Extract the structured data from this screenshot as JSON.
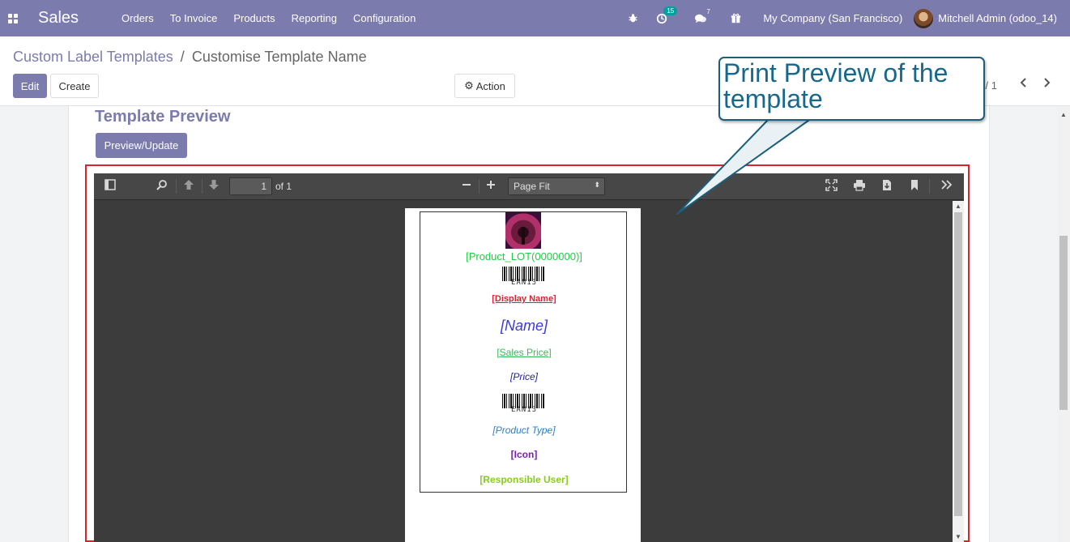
{
  "navbar": {
    "app_name": "Sales",
    "menu": [
      "Orders",
      "To Invoice",
      "Products",
      "Reporting",
      "Configuration"
    ],
    "activity_badge": "15",
    "messages_count": "7",
    "company": "My Company (San Francisco)",
    "user": "Mitchell Admin (odoo_14)"
  },
  "breadcrumb": {
    "parent": "Custom Label Templates",
    "separator": "/",
    "current": "Customise Template Name"
  },
  "buttons": {
    "edit": "Edit",
    "create": "Create",
    "action": "Action",
    "preview_update": "Preview/Update"
  },
  "pager": {
    "value": "1 / 1"
  },
  "section": {
    "title": "Template Preview"
  },
  "pdf_viewer": {
    "page_number": "1",
    "of_total": "of 1",
    "zoom": "Page Fit"
  },
  "label": {
    "product_lot": "[Product_LOT(0000000)]",
    "barcode1_text": "EAN13",
    "display_name": "[Display Name]",
    "name": "[Name]",
    "sales_price": "[Sales Price]",
    "price": "[Price]",
    "barcode2_text": "EAN13",
    "product_type": "[Product Type]",
    "icon": "[Icon]",
    "responsible_user": "[Responsible User]"
  },
  "colors": {
    "brand": "#7c7bad",
    "lot": "#22cc44",
    "display_name": "#d9242d",
    "name": "#3a3adb",
    "sales_price": "#33bb55",
    "price": "#22229a",
    "product_type": "#2f7fc1",
    "icon": "#7a1fb5",
    "responsible_user": "#88cc22"
  },
  "callout": {
    "text": "Print Preview of the template"
  }
}
